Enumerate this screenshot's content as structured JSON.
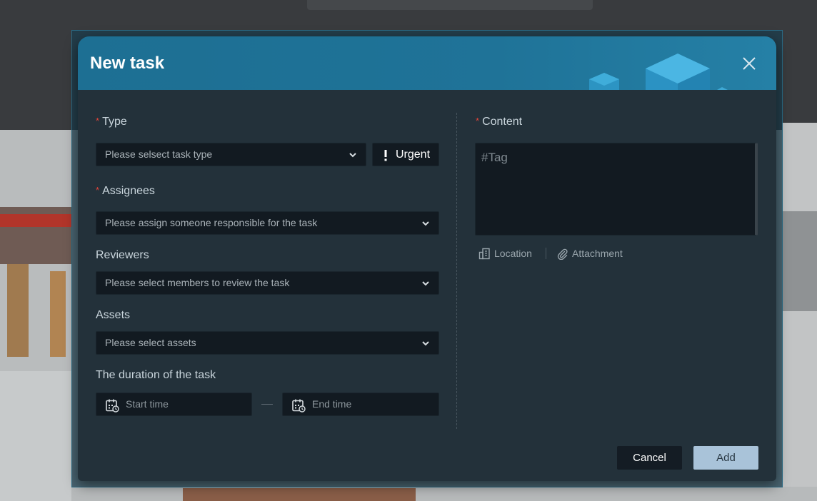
{
  "dialog": {
    "title": "New task"
  },
  "form": {
    "type": {
      "label": "Type",
      "placeholder": "Please selsect task type",
      "urgent_label": "Urgent"
    },
    "assignees": {
      "label": "Assignees",
      "placeholder": "Please assign someone responsible for the task"
    },
    "reviewers": {
      "label": "Reviewers",
      "placeholder": "Please select members to review the task"
    },
    "assets": {
      "label": "Assets",
      "placeholder": "Please select assets"
    },
    "duration": {
      "label": "The duration of the task",
      "start_placeholder": "Start time",
      "end_placeholder": "End time"
    },
    "content": {
      "label": "Content",
      "placeholder": "#Tag",
      "location_label": "Location",
      "attachment_label": "Attachment"
    }
  },
  "footer": {
    "cancel_label": "Cancel",
    "add_label": "Add"
  },
  "colors": {
    "header": "#1f7398",
    "required": "#e0443a",
    "add_button": "#a9c3d9"
  }
}
